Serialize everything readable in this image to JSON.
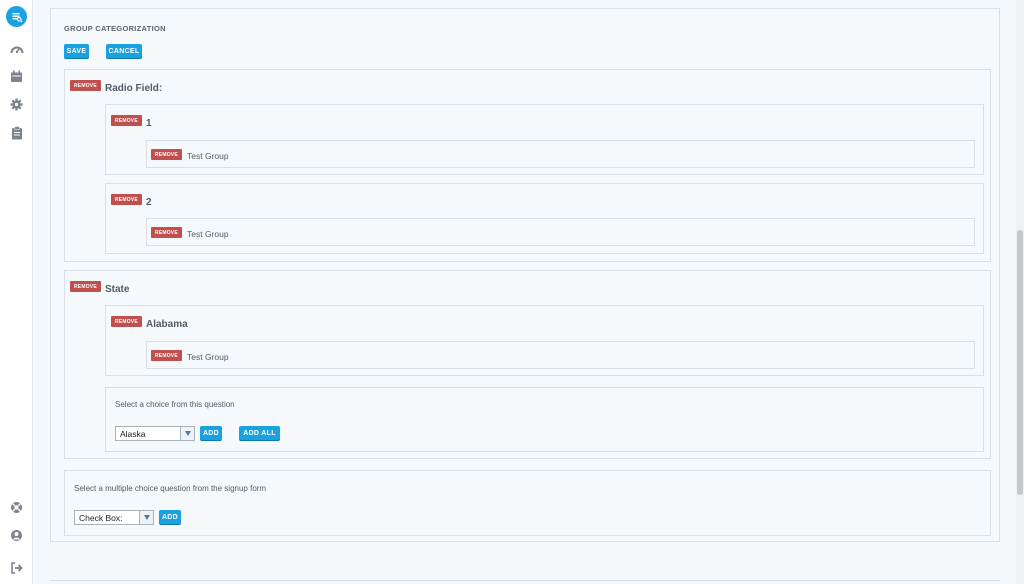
{
  "page": {
    "title": "GROUP CATEGORIZATION",
    "save_label": "SAVE",
    "cancel_label": "CANCEL"
  },
  "remove_label": "REMOVE",
  "questions": [
    {
      "name": "Radio Field:",
      "choices": [
        {
          "name": "1",
          "groups": [
            "Test Group"
          ]
        },
        {
          "name": "2",
          "groups": [
            "Test Group"
          ]
        }
      ]
    },
    {
      "name": "State",
      "choices": [
        {
          "name": "Alabama",
          "groups": [
            "Test Group"
          ]
        }
      ],
      "choice_picker": {
        "hint": "Select a choice from this question",
        "selected": "Alaska",
        "add_label": "ADD",
        "add_all_label": "ADD ALL"
      }
    }
  ],
  "question_picker": {
    "hint": "Select a multiple choice question from the signup form",
    "selected": "Check Box:",
    "add_label": "ADD"
  },
  "colors": {
    "primary": "#1aa1e0",
    "remove": "#c0504d"
  },
  "icons": {
    "logo": "search-list-icon",
    "nav": [
      "dashboard-icon",
      "calendar-icon",
      "gear-icon",
      "clipboard-icon"
    ],
    "bottom": [
      "help-icon",
      "user-icon",
      "logout-icon"
    ]
  }
}
